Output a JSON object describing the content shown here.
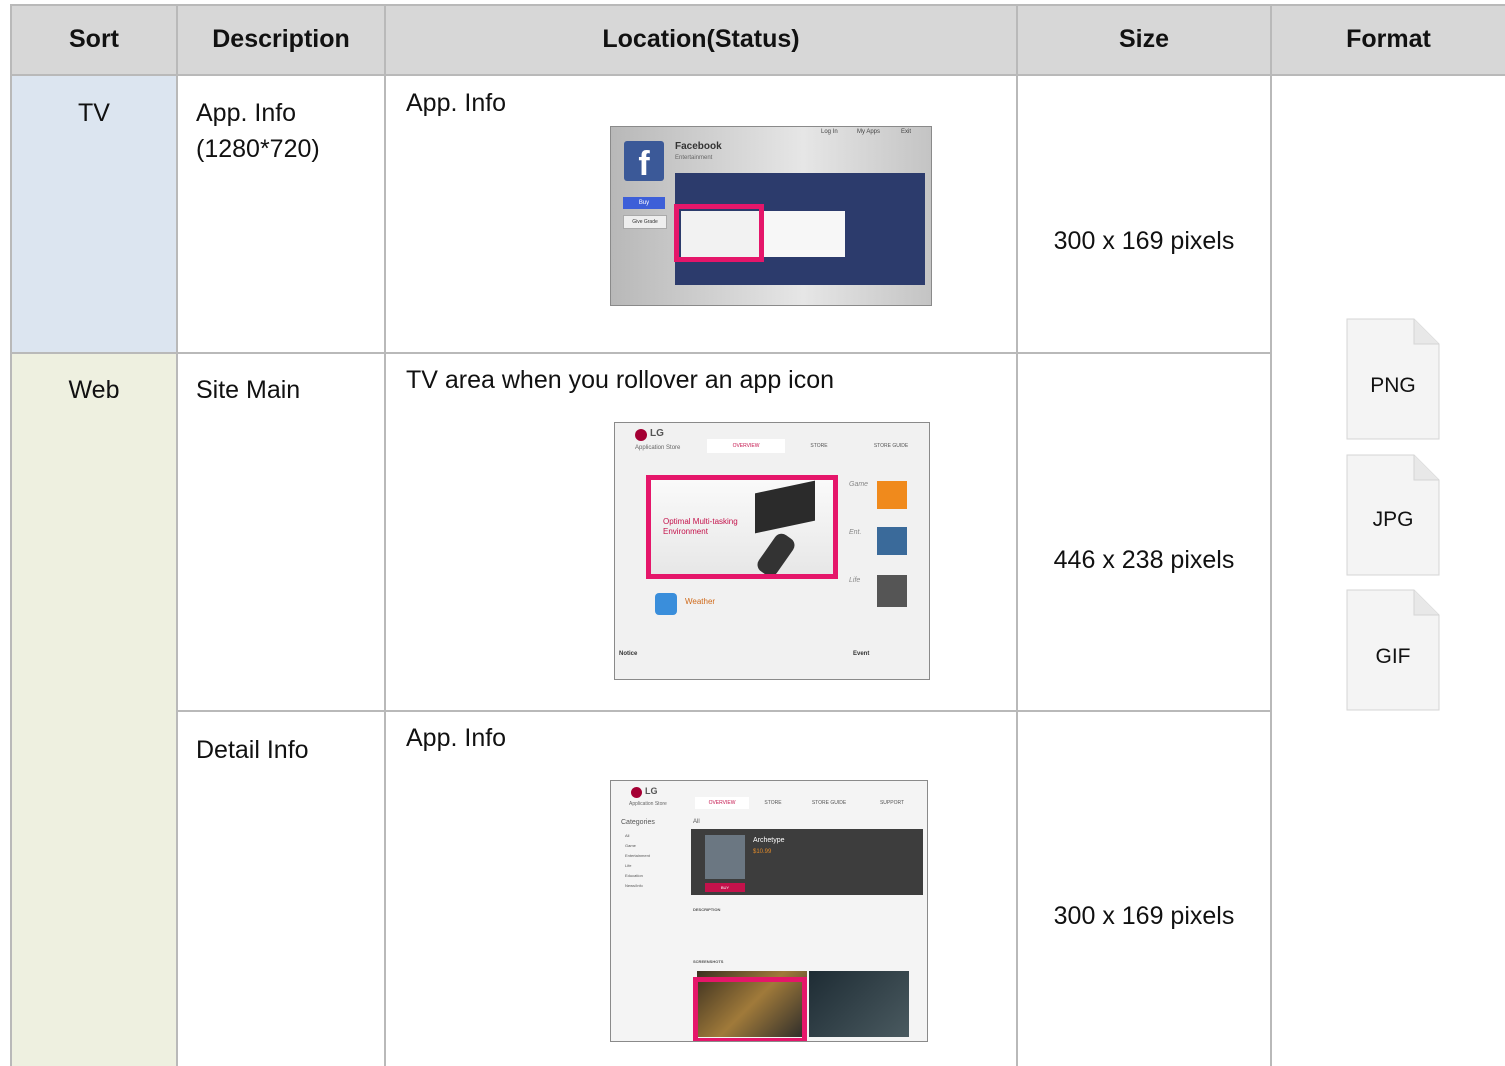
{
  "columns": [
    "Sort",
    "Description",
    "Location(Status)",
    "Size",
    "Format"
  ],
  "rows": [
    {
      "sort": "TV",
      "description": "App. Info (1280*720)",
      "location": "App. Info",
      "size": "300 x 169 pixels"
    },
    {
      "sort": "Web",
      "description": "Site Main",
      "location": "TV area when you rollover an app icon",
      "size": "446 x 238 pixels"
    },
    {
      "sort": "",
      "description": "Detail Info",
      "location": "App. Info",
      "size": "300 x 169 pixels"
    }
  ],
  "formats": [
    "PNG",
    "JPG",
    "GIF"
  ],
  "tv_shot": {
    "app_name": "Facebook",
    "category": "Entertainment",
    "buy": "Buy",
    "give_grade": "Give Grade",
    "login": "Log In",
    "my_apps": "My Apps",
    "exit": "Exit"
  },
  "web_shot": {
    "brand": "LG",
    "store": "Application Store",
    "tabs": [
      "OVERVIEW",
      "STORE",
      "STORE GUIDE"
    ],
    "banner": "Optimal Multi-tasking Environment",
    "side": [
      "Game",
      "Ent.",
      "Life"
    ],
    "weather": "Weather",
    "notice": "Notice",
    "event": "Event"
  },
  "detail_shot": {
    "brand": "LG",
    "store": "Application Store",
    "tabs": [
      "OVERVIEW",
      "STORE",
      "STORE GUIDE",
      "SUPPORT"
    ],
    "categories_title": "Categories",
    "categories": [
      "All",
      "Game",
      "Entertainment",
      "Life",
      "Education",
      "News/Info"
    ],
    "all": "All",
    "app": "Archetype",
    "price": "$10.99",
    "buy": "BUY",
    "description": "DESCRIPTION",
    "screenshots": "SCREENSHOTS"
  },
  "colors": {
    "header_bg": "#d7d7d7",
    "tv_bg": "#dce5f0",
    "web_bg": "#eef0e0",
    "highlight": "#e5166a",
    "grid_line": "#b9b9b9"
  }
}
